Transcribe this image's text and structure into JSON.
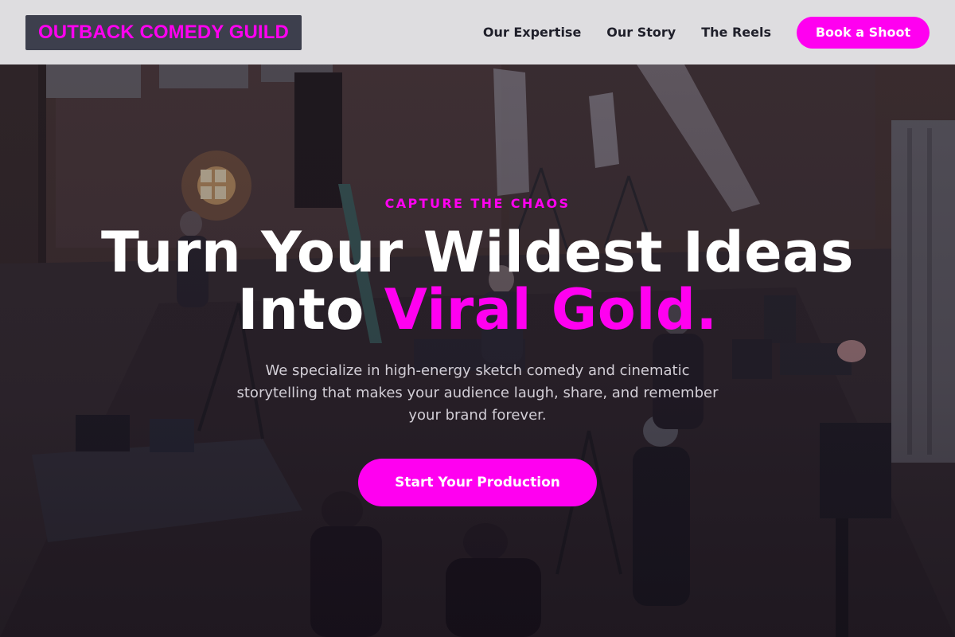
{
  "brand": {
    "logo_text": "OUTBACK COMEDY GUILD",
    "accent_color": "#ff00f0"
  },
  "nav": {
    "links": [
      {
        "label": "Our Expertise"
      },
      {
        "label": "Our Story"
      },
      {
        "label": "The Reels"
      }
    ],
    "cta_label": "Book a Shoot"
  },
  "hero": {
    "background_image": "film-set-warehouse",
    "eyebrow": "CAPTURE THE CHAOS",
    "headline_line1": "Turn Your Wildest Ideas",
    "headline_line2_prefix": "Into ",
    "headline_line2_accent": "Viral Gold.",
    "subtext": "We specialize in high-energy sketch comedy and cinematic storytelling that makes your audience laugh, share, and remember your brand forever.",
    "cta_label": "Start Your Production"
  }
}
